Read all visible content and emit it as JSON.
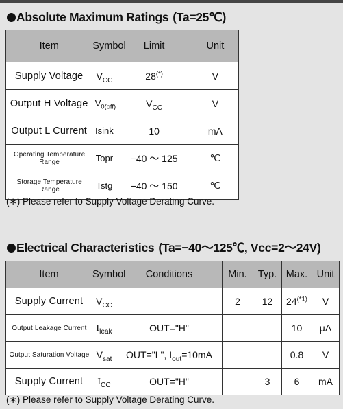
{
  "page": {
    "background": "#e4e4e4",
    "header_fill": "#b8b8b8",
    "border_color": "#333333"
  },
  "sections": [
    {
      "id": "absolute-maximum-ratings",
      "heading_title": "Absolute Maximum Ratings",
      "heading_condition": "(Ta=25℃)",
      "columns": [
        "Item",
        "Symbol",
        "Limit",
        "Unit"
      ],
      "rows": [
        {
          "item": "Supply  Voltage",
          "symbol_base": "V",
          "symbol_sub": "CC",
          "limit_base": "28",
          "limit_sup": "(*)",
          "unit": "V"
        },
        {
          "item": "Output H Voltage",
          "symbol_base": "V",
          "symbol_sub": "0(off)",
          "limit_base": "V",
          "limit_sub": "CC",
          "limit_sup": "",
          "unit": "V"
        },
        {
          "item": "Output L Current",
          "symbol_base": "Isink",
          "symbol_sub": "",
          "limit_base": "10",
          "limit_sup": "",
          "unit": "mA"
        },
        {
          "item": "Operating  Temperature  Range",
          "symbol_base": "Topr",
          "symbol_sub": "",
          "limit_base": "−40 ～ 125",
          "limit_sup": "",
          "unit": "℃"
        },
        {
          "item": "Storage Temperature Range",
          "symbol_base": "Tstg",
          "symbol_sub": "",
          "limit_base": "−40 ～ 150",
          "limit_sup": "",
          "unit": "℃"
        }
      ],
      "note": "(∗) Please refer to Supply Voltage Derating Curve."
    },
    {
      "id": "electrical-characteristics",
      "heading_title": "Electrical Characteristics",
      "heading_condition": "(Ta=−40～125℃, Vcc=2～24V)",
      "columns": [
        "Item",
        "Symbol",
        "Conditions",
        "Min.",
        "Typ.",
        "Max.",
        "Unit"
      ],
      "rows": [
        {
          "item": "Supply   Current",
          "symbol_base": "V",
          "symbol_sub": "CC",
          "cond_pre": "",
          "cond_sub": "",
          "cond_post": "",
          "min": "2",
          "typ": "12",
          "max_base": "24",
          "max_sup": "(*1)",
          "unit": "V"
        },
        {
          "item": "Output Leakage Current",
          "symbol_base": "I",
          "symbol_sub": "leak",
          "cond_pre": "OUT=\"H\"",
          "cond_sub": "",
          "cond_post": "",
          "min": "",
          "typ": "",
          "max_base": "10",
          "max_sup": "",
          "unit": "μA"
        },
        {
          "item": "Output  Saturation  Voltage",
          "symbol_base": "V",
          "symbol_sub": "sat",
          "cond_pre": "OUT=\"L\", I",
          "cond_sub": "out",
          "cond_post": "=10mA",
          "min": "",
          "typ": "",
          "max_base": "0.8",
          "max_sup": "",
          "unit": "V"
        },
        {
          "item": "Supply   Current",
          "symbol_base": "I",
          "symbol_sub": "CC",
          "cond_pre": "OUT=\"H\"",
          "cond_sub": "",
          "cond_post": "",
          "min": "",
          "typ": "3",
          "max_base": "6",
          "max_sup": "",
          "unit": "mA"
        }
      ],
      "note": "(∗) Please refer to Supply Voltage Derating Curve."
    }
  ]
}
